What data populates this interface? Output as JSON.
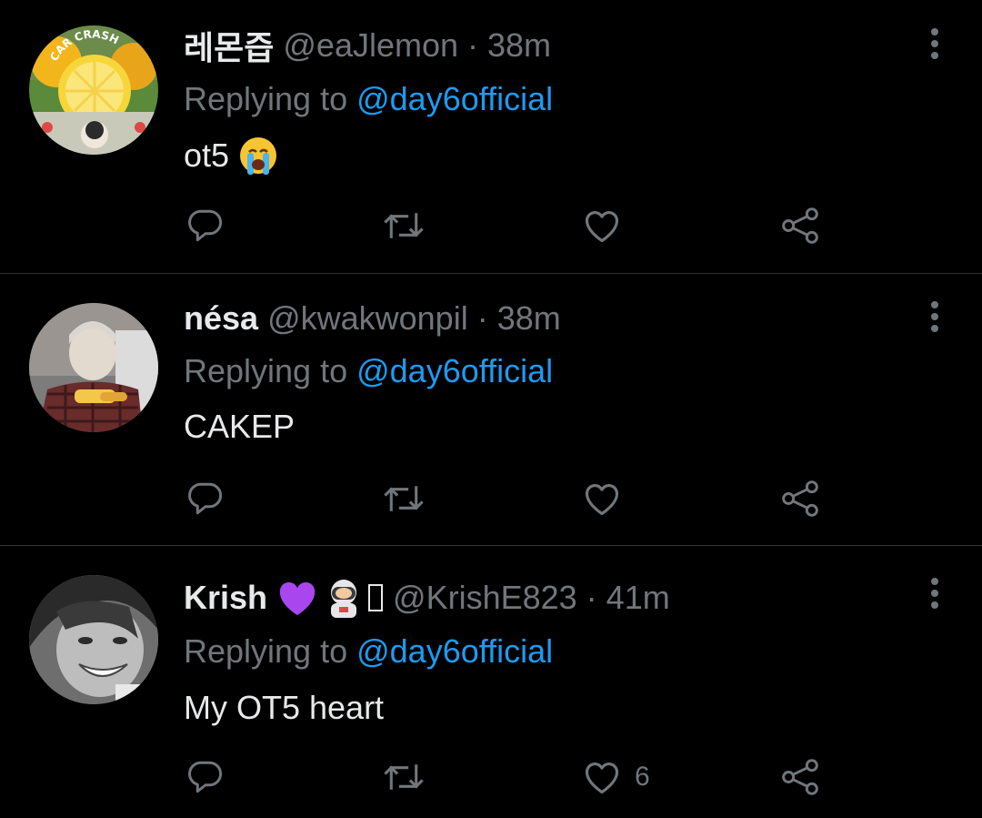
{
  "tweets": [
    {
      "name": "레몬즙",
      "handle": "@eaJlemon",
      "separator": "·",
      "time": "38m",
      "reply_prefix": "Replying to",
      "reply_mention": "@day6official",
      "text": "ot5",
      "text_emoji": "loudly-crying-face-emoji",
      "avatar_text": "CAR CRASH",
      "like_count": ""
    },
    {
      "name": "nésa",
      "handle": "@kwakwonpil",
      "separator": "·",
      "time": "38m",
      "reply_prefix": "Replying to",
      "reply_mention": "@day6official",
      "text": "CAKEP",
      "like_count": ""
    },
    {
      "name": "Krish",
      "name_emojis": [
        "purple-heart-emoji",
        "astronaut-emoji",
        "missing-glyph"
      ],
      "handle": "@KrishE823",
      "separator": "·",
      "time": "41m",
      "reply_prefix": "Replying to",
      "reply_mention": "@day6official",
      "text": "My OT5 heart",
      "like_count": "6"
    }
  ],
  "actions": [
    "reply-icon",
    "retweet-icon",
    "like-icon",
    "share-icon"
  ],
  "colors": {
    "background": "#000000",
    "primary_text": "#e7e9ea",
    "secondary_text": "#71767b",
    "mention": "#1d9bf0",
    "divider": "#2f3336",
    "purple_heart": "#aa46f0"
  }
}
